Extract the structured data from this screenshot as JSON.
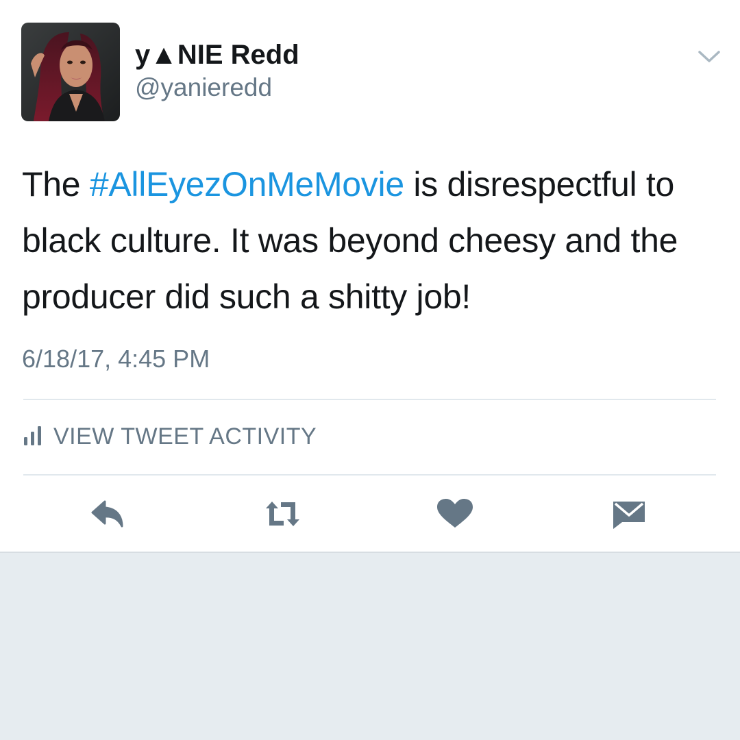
{
  "tweet": {
    "author": {
      "display_name": "y▲NIE Redd",
      "handle": "@yanieredd"
    },
    "text": {
      "before": "The ",
      "hashtag": "#AllEyezOnMeMovie",
      "after": " is disrespectful to black culture. It was beyond cheesy and the producer did such a shitty job!"
    },
    "timestamp": "6/18/17, 4:45 PM",
    "activity_label": "VIEW TWEET ACTIVITY",
    "actions": {
      "reply_icon": "reply-icon",
      "retweet_icon": "retweet-icon",
      "like_icon": "heart-icon",
      "dm_icon": "envelope-icon"
    }
  },
  "colors": {
    "hashtag": "#1b95e0",
    "text": "#14171a",
    "muted": "#657786",
    "background": "#e6ecf0"
  }
}
